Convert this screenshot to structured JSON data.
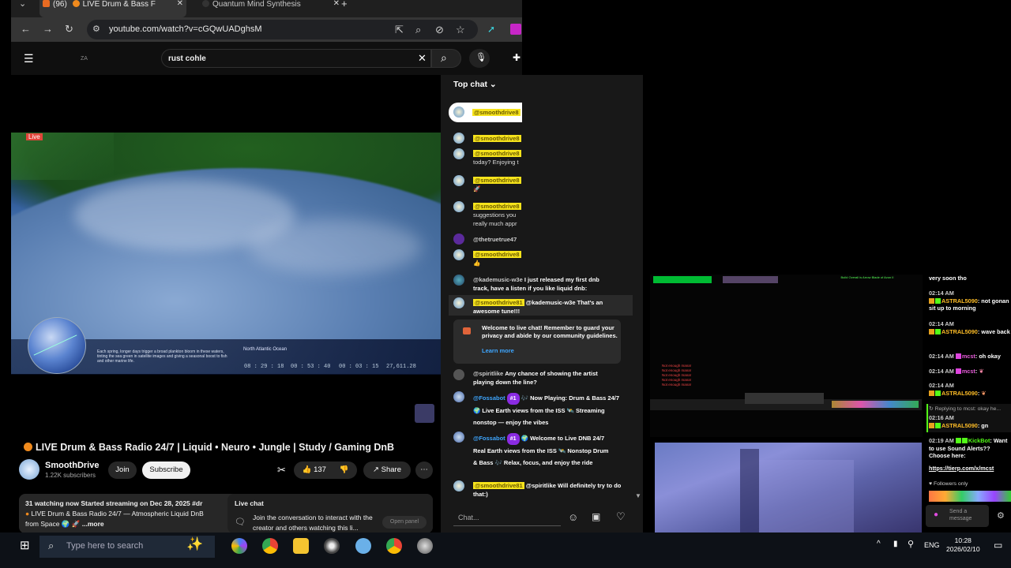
{
  "browser": {
    "tabs": [
      {
        "label": "(96)",
        "title": "LIVE Drum & Bass F"
      },
      {
        "label": "Quantum Mind Synthesis"
      }
    ],
    "new_tab": "+",
    "url": "youtube.com/watch?v=cGQwUADghsM"
  },
  "youtube": {
    "search_value": "rust cohle",
    "logo_text": "ZA",
    "video": {
      "live_badge": "Live",
      "overlay_caption": "Each spring, longer days trigger a broad plankton bloom in these waters, tinting the sea green in satellite images and giving a seasonal boost to fish and other marine life.",
      "location_label": "North Atlantic Ocean",
      "time_values": [
        "08 : 29 : 18",
        "00 : 53 : 40",
        "00 : 03 : 15",
        "27,611.28"
      ],
      "title": "LIVE Drum & Bass Radio 24/7 | Liquid • Neuro • Jungle | Study / Gaming DnB"
    },
    "channel": {
      "name": "SmoothDrive",
      "subscribers": "1.22K subscribers"
    },
    "actions": {
      "join": "Join",
      "subscribe": "Subscribe",
      "likes": "137",
      "share": "Share"
    },
    "description": {
      "line1": "31 watching now  Started streaming on Dec 28, 2025  #dr",
      "line2": "LIVE Drum & Bass Radio 24/7 — Atmospheric Liquid DnB",
      "line3": "from Space",
      "more": "...more"
    },
    "live_chat_box": {
      "title": "Live chat",
      "text": "Join the conversation to interact with the creator and others watching this li...",
      "button": "Open panel"
    }
  },
  "chat": {
    "header": "Top chat",
    "pinned_user": "@smoothdrive8",
    "messages": [
      {
        "user": "@smoothdrive8",
        "text": ""
      },
      {
        "user": "@smoothdrive8",
        "text": "today? Enjoying t"
      },
      {
        "user": "@smoothdrive8",
        "text": "🚀"
      },
      {
        "user": "@smoothdrive8",
        "text": "suggestions you really much appr"
      },
      {
        "user": "@thetruetrue47",
        "text": ""
      },
      {
        "user": "@smoothdrive8",
        "text": "👍"
      },
      {
        "user": "@kademusic-w3e",
        "text": "I just released my first dnb track, have a listen if you like liquid dnb:"
      },
      {
        "user": "@smoothdrive81",
        "text": "@kademusic-w3e That's an awesome tune!!!"
      }
    ],
    "welcome_text": "Welcome to live chat! Remember to guard your privacy and abide by our community guidelines.",
    "learn_more": "Learn more",
    "messages2": [
      {
        "user": "@spiritlike",
        "text": "Any chance of showing the artist playing down the line?"
      },
      {
        "user": "@Fossabot",
        "badge": "#1",
        "text": "🎶 Now Playing: Drum & Bass 24/7 🌍 Live Earth views from the ISS 🛰️ Streaming nonstop — enjoy the vibes"
      },
      {
        "user": "@Fossabot",
        "badge": "#1",
        "text": "🌍 Welcome to Live DNB 24/7 Real Earth views from the ISS 🛰️ Nonstop Drum & Bass 🎶 Relax, focus, and enjoy the ride"
      },
      {
        "user": "@smoothdrive81",
        "text": "@spiritlike Will definitely try to do that:)"
      }
    ],
    "input_placeholder": "Chat..."
  },
  "stream_chat": {
    "lines": [
      {
        "time": "",
        "user": "",
        "text": "very soon tho"
      },
      {
        "time": "02:14 AM",
        "user": "ASTRAL5090",
        "text": ": not gonan sit up to morning"
      },
      {
        "time": "02:14 AM",
        "user": "ASTRAL5090",
        "text": ": wave back"
      },
      {
        "time": "02:14 AM",
        "user": "mcst",
        "text": ": oh okay"
      },
      {
        "time": "02:14 AM",
        "user": "mcst",
        "text": ":"
      },
      {
        "time": "02:14 AM",
        "user": "ASTRAL5090",
        "text": ":"
      },
      {
        "time": "",
        "user": "",
        "text": "Replying to mcst: okay he..."
      },
      {
        "time": "02:16 AM",
        "user": "ASTRAL5090",
        "text": ": gn"
      },
      {
        "time": "02:19 AM",
        "user": "KickBot",
        "text": ": Want to use Sound Alerts?? Choose here:"
      },
      {
        "time": "",
        "user": "",
        "text": "https://tierp.com/x/mcst"
      },
      {
        "time": "",
        "user": "",
        "text": "Followers only"
      }
    ],
    "send_placeholder": "Send a message"
  },
  "game_ui": {
    "kill_text": "Not enough mana!",
    "caption_green": "Build Overall is Arrow Blade of Avon II"
  },
  "taskbar": {
    "search_placeholder": "Type here to search",
    "language": "ENG",
    "time": "10:28",
    "date": "2026/02/10"
  }
}
